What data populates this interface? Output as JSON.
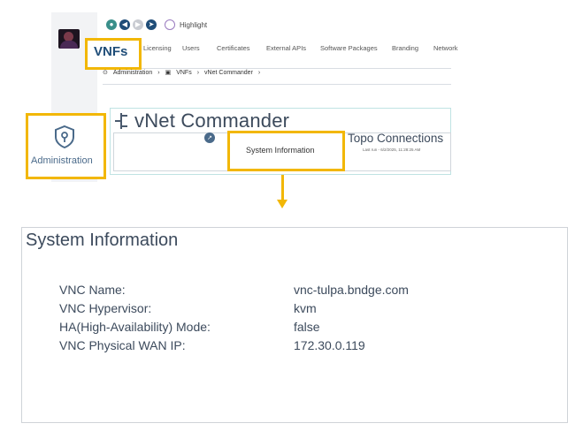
{
  "toolbar": {
    "highlight_label": "Highlight"
  },
  "nav": {
    "vnfs": "VNFs",
    "tabs": [
      "Licensing",
      "Users",
      "Certificates",
      "External APIs",
      "Software Packages",
      "Branding",
      "Network"
    ]
  },
  "breadcrumb": [
    "Administration",
    "VNFs",
    "vNet Commander"
  ],
  "page": {
    "title": "vNet Commander",
    "system_info_label": "System Information",
    "topo_title": "Topo Connections",
    "topo_last_run": "Last run - 6/2/2025, 11:28:25 AM"
  },
  "sidebar": {
    "admin_label": "Administration"
  },
  "detail": {
    "title": "System Information",
    "rows": [
      {
        "key": "VNC Name:",
        "value": "vnc-tulpa.bndge.com"
      },
      {
        "key": "VNC Hypervisor:",
        "value": "kvm"
      },
      {
        "key": "HA(High-Availability) Mode:",
        "value": "false"
      },
      {
        "key": "VNC Physical WAN IP:",
        "value": "172.30.0.119"
      }
    ]
  },
  "colors": {
    "highlight": "#f2b705",
    "brand": "#1f4d78",
    "text": "#3c4a5c"
  }
}
